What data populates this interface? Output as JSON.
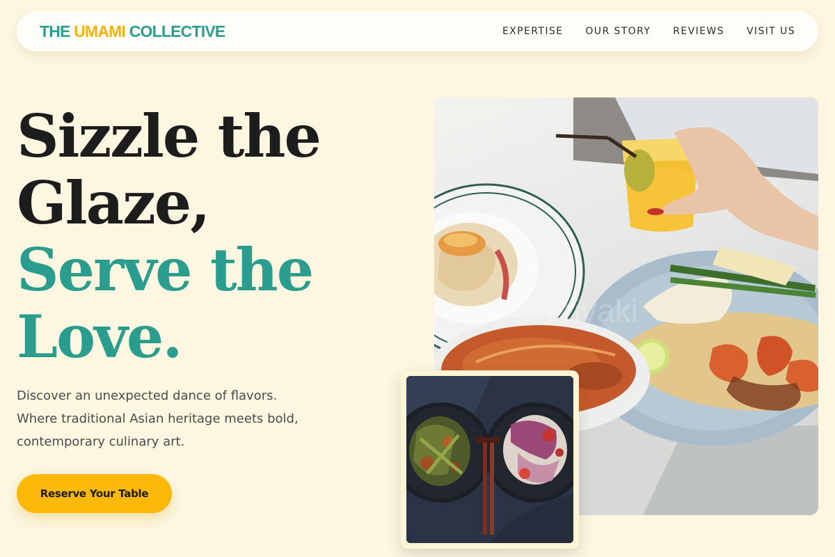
{
  "nav": {
    "logo_part1": "THE ",
    "logo_accent": "UMAMI",
    "logo_part2": " COLLECTIVE",
    "links": [
      "EXPERTISE",
      "OUR STORY",
      "REVIEWS",
      "VISIT US"
    ]
  },
  "hero": {
    "headline_dark": [
      "Sizzle the",
      "Glaze,"
    ],
    "headline_teal": [
      "Serve the",
      "Love."
    ],
    "description_lines": [
      "Discover an unexpected dance of flavors.",
      "Where traditional Asian heritage meets bold,",
      "contemporary culinary art."
    ],
    "cta_label": "Reserve Your Table"
  },
  "colors": {
    "background": "#fdf7e1",
    "brand_teal": "#2a9d8f",
    "brand_yellow": "#f2b30b",
    "cta": "#fdb90a"
  },
  "images": {
    "main": "photo-asian-dishes-table",
    "inset": "photo-two-bowls-chopsticks",
    "watermark": "eriyaki"
  }
}
